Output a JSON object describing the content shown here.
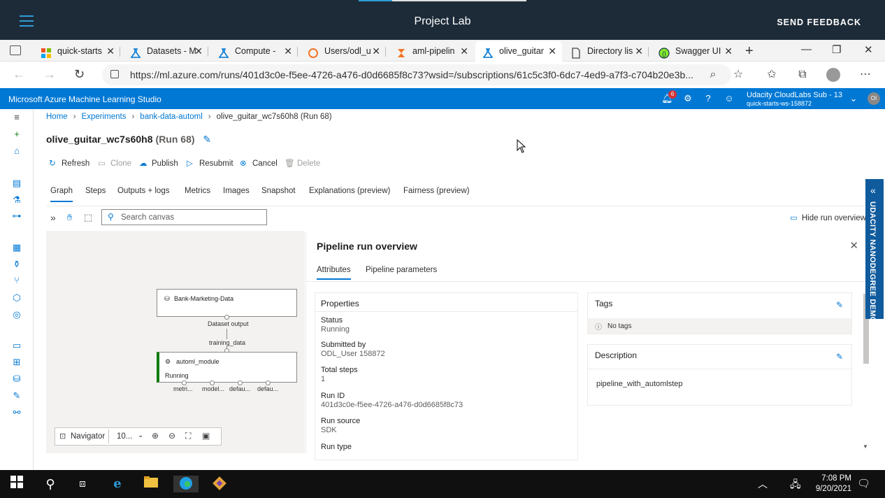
{
  "lab": {
    "title": "Project Lab",
    "feedback": "SEND FEEDBACK"
  },
  "browser": {
    "tabs": [
      {
        "label": "quick-starts",
        "icon": "ms-logo-icon"
      },
      {
        "label": "Datasets - M",
        "icon": "azure-ml-icon"
      },
      {
        "label": "Compute - ",
        "icon": "azure-ml-icon"
      },
      {
        "label": "Users/odl_u",
        "icon": "jupyter-icon"
      },
      {
        "label": "aml-pipelin",
        "icon": "hourglass-icon"
      },
      {
        "label": "olive_guitar",
        "icon": "azure-ml-icon"
      },
      {
        "label": "Directory lis",
        "icon": "page-icon"
      },
      {
        "label": "Swagger UI",
        "icon": "swagger-icon"
      }
    ],
    "url": "https://ml.azure.com/runs/401d3c0e-f5ee-4726-a476-d0d6685f8c73?wsid=/subscriptions/61c5c3f0-6dc7-4ed9-a7f3-c704b20e3b..."
  },
  "azure": {
    "brand": "Microsoft Azure Machine Learning Studio",
    "notif_count": "6",
    "subscription": "Udacity CloudLabs Sub - 13",
    "workspace": "quick-starts-ws-158872",
    "avatar": "OI"
  },
  "breadcrumb": {
    "home": "Home",
    "experiments": "Experiments",
    "experiment": "bank-data-automl",
    "run": "olive_guitar_wc7s60h8 (Run 68)"
  },
  "page": {
    "title": "olive_guitar_wc7s60h8",
    "run": "(Run 68)"
  },
  "commands": {
    "refresh": "Refresh",
    "clone": "Clone",
    "publish": "Publish",
    "resubmit": "Resubmit",
    "cancel": "Cancel",
    "delete": "Delete"
  },
  "tabs": [
    "Graph",
    "Steps",
    "Outputs + logs",
    "Metrics",
    "Images",
    "Snapshot",
    "Explanations (preview)",
    "Fairness (preview)"
  ],
  "canvas": {
    "search_placeholder": "Search canvas",
    "hide_overview": "Hide run overview",
    "node1": "Bank-Marketing-Data",
    "dataset_output": "Dataset output",
    "training_data": "training_data",
    "node2": "automl_module",
    "node2_status": "Running",
    "outputs": [
      "metri...",
      "model...",
      "defau...",
      "defau..."
    ],
    "navigator": "Navigator",
    "zoom": "10..."
  },
  "overview": {
    "title": "Pipeline run overview",
    "tab_attributes": "Attributes",
    "tab_params": "Pipeline parameters",
    "properties_header": "Properties",
    "status_label": "Status",
    "status_value": "Running",
    "submitted_label": "Submitted by",
    "submitted_value": "ODL_User 158872",
    "steps_label": "Total steps",
    "steps_value": "1",
    "runid_label": "Run ID",
    "runid_value": "401d3c0e-f5ee-4726-a476-d0d6685f8c73",
    "source_label": "Run source",
    "source_value": "SDK",
    "type_label": "Run type",
    "tags_header": "Tags",
    "no_tags": "No tags",
    "desc_header": "Description",
    "desc_value": "pipeline_with_automlstep"
  },
  "side_banner": "UDACITY NANODEGREE DEMO",
  "clock": {
    "time": "7:08 PM",
    "date": "9/20/2021"
  },
  "colors": {
    "accent": "#0078d4",
    "labbar": "#1d2b38",
    "running": "#107c10"
  }
}
